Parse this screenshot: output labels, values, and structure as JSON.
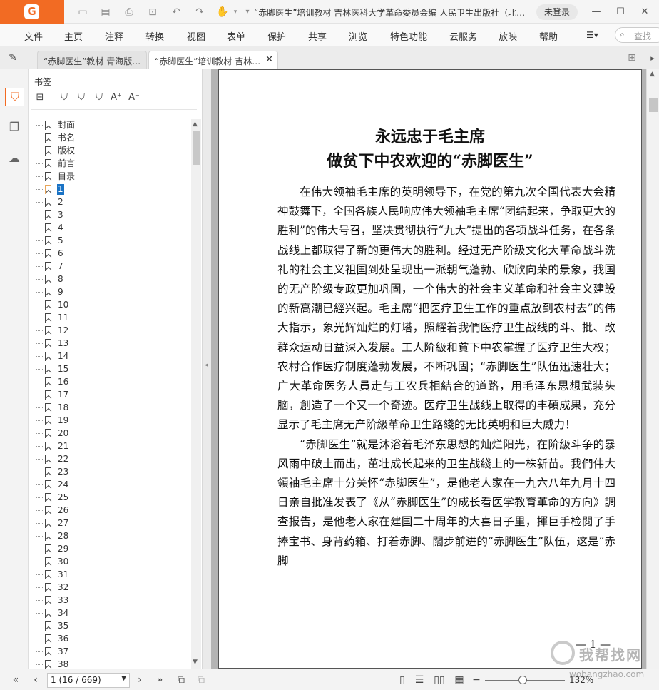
{
  "app": {
    "title": "“赤脚医生”培训教材 吉林医科大学革命委员会编 人民卫生出版社（北…",
    "login_label": "未登录",
    "accent_color": "#f26b23"
  },
  "toolbar_icons": [
    "open-icon",
    "save-icon",
    "print-icon",
    "export-icon",
    "undo-icon",
    "redo-icon",
    "hand-tool-icon"
  ],
  "menu": {
    "items": [
      "文件",
      "主页",
      "注释",
      "转换",
      "视图",
      "表单",
      "保护",
      "共享",
      "浏览",
      "特色功能",
      "云服务",
      "放映",
      "帮助"
    ],
    "search_placeholder": "查找"
  },
  "tabs": [
    {
      "label": "“赤脚医生”教材 青海版…"
    },
    {
      "label": "“赤脚医生”培训教材 吉林…"
    }
  ],
  "bookmarks": {
    "title": "书签",
    "items": [
      "封面",
      "书名",
      "版权",
      "前言",
      "目录",
      "1",
      "2",
      "3",
      "4",
      "5",
      "6",
      "7",
      "8",
      "9",
      "10",
      "11",
      "12",
      "13",
      "14",
      "15",
      "16",
      "17",
      "18",
      "19",
      "20",
      "21",
      "22",
      "23",
      "24",
      "25",
      "26",
      "27",
      "28",
      "29",
      "30",
      "31",
      "32",
      "33",
      "34",
      "35",
      "36",
      "37",
      "38"
    ],
    "selected": "1"
  },
  "page": {
    "title_line1": "永远忠于毛主席",
    "title_line2": "做贫下中农欢迎的“赤脚医生”",
    "para1": "在伟大领袖毛主席的英明领导下，在党的第九次全国代表大会精神鼓舞下，全国各族人民响应伟大领袖毛主席“团结起来，争取更大的胜利”的伟大号召，坚决贯彻执行“九大”提出的各项战斗任务，在各条战线上都取得了新的更伟大的胜利。经过无产阶级文化大革命战斗洗礼的社会主义祖国到处呈现出一派朝气蓬勃、欣欣向荣的景象，我国的无产阶级专政更加巩固，一个伟大的社会主义革命和社会主义建設的新高潮已經兴起。毛主席“把医疗卫生工作的重点放到农村去”的伟大指示，象光辉灿烂的灯塔，照耀着我們医疗卫生战线的斗、批、改群众运动日益深入发展。工人阶級和貧下中农掌握了医疗卫生大权；农村合作医疗制度蓬勃发展，不断巩固；“赤脚医生”队伍迅速壮大；广大革命医务人員走与工农兵相結合的道路，用毛泽东思想武装头脑，創造了一个又一个奇迹。医疗卫生战线上取得的丰碩成果，充分显示了毛主席无产阶級革命卫生路綫的无比英明和巨大威力！",
    "para2": "“赤脚医生”就是沐浴着毛泽东思想的灿烂阳光，在阶級斗争的暴风雨中破土而出，茁壮成长起来的卫生战綫上的一株新苗。我們伟大領袖毛主席十分关怀“赤脚医生”，是他老人家在一九六八年九月十四日亲自批准发表了《从“赤脚医生”的成长看医学教育革命的方向》調查报告，是他老人家在建国二十周年的大喜日子里，揮巨手检閱了手捧宝书、身背药箱、打着赤脚、闊步前进的“赤脚医生”队伍，这是“赤脚",
    "page_number": "— 1 —"
  },
  "status": {
    "page_indicator": "1 (16 / 669)",
    "zoom": "132%"
  },
  "watermark": {
    "text": "我帮找网",
    "url": "wobangzhao.com"
  }
}
